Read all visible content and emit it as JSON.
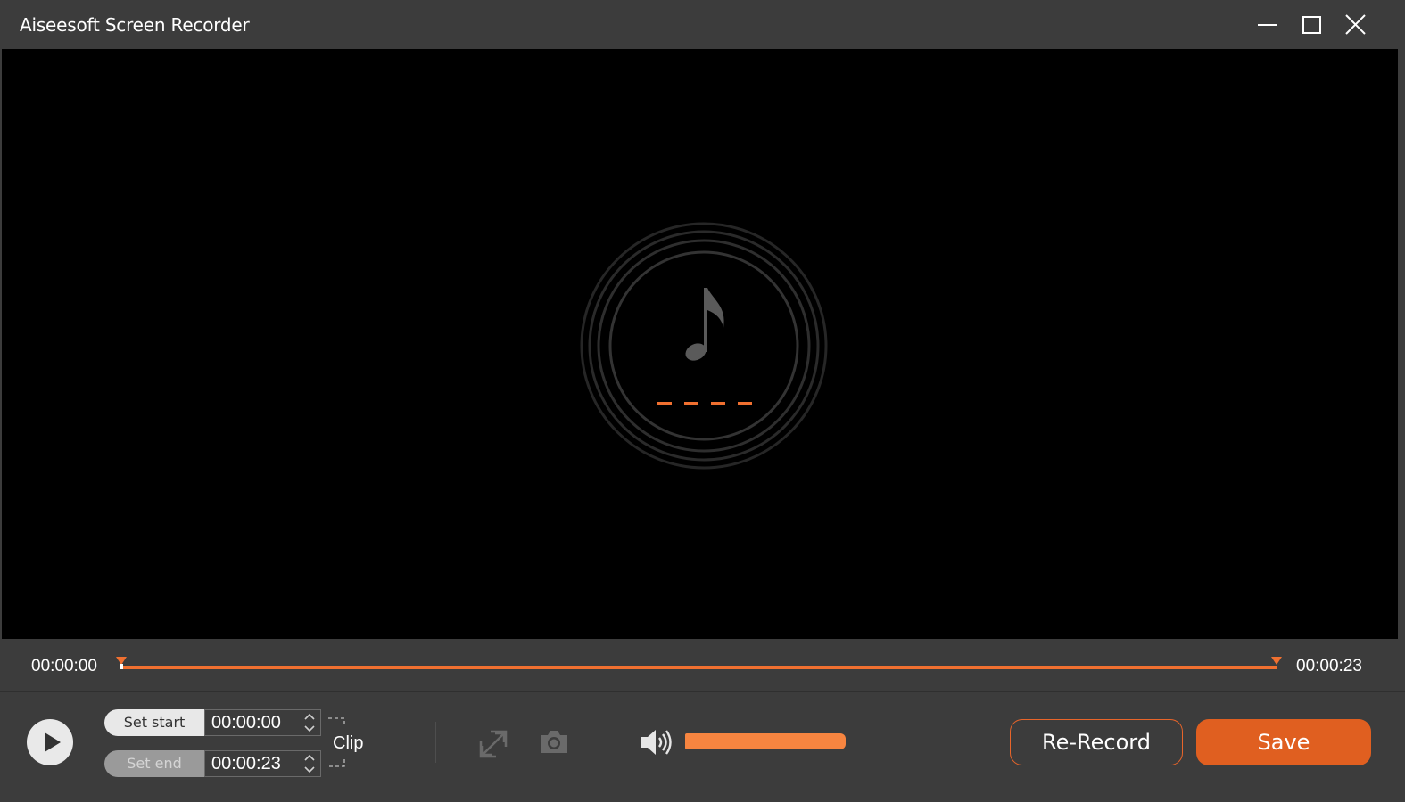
{
  "window": {
    "title": "Aiseesoft Screen Recorder"
  },
  "timeline": {
    "start_time": "00:00:00",
    "end_time": "00:00:23"
  },
  "clip": {
    "set_start_label": "Set start",
    "set_end_label": "Set end",
    "start_value": "00:00:00",
    "end_value": "00:00:23",
    "clip_label": "Clip"
  },
  "volume": {
    "level_fraction": 1.0
  },
  "actions": {
    "rerecord_label": "Re-Record",
    "save_label": "Save"
  },
  "colors": {
    "accent": "#e05f20",
    "track": "#f07030",
    "volume": "#f78540",
    "background": "#3c3c3c",
    "preview": "#000000"
  },
  "icons": {
    "preview_center": "music-note-icon",
    "play": "play-icon",
    "expand": "expand-icon",
    "camera": "camera-icon",
    "volume": "volume-icon",
    "minimize": "minimize-icon",
    "maximize": "maximize-icon",
    "close": "close-icon"
  }
}
